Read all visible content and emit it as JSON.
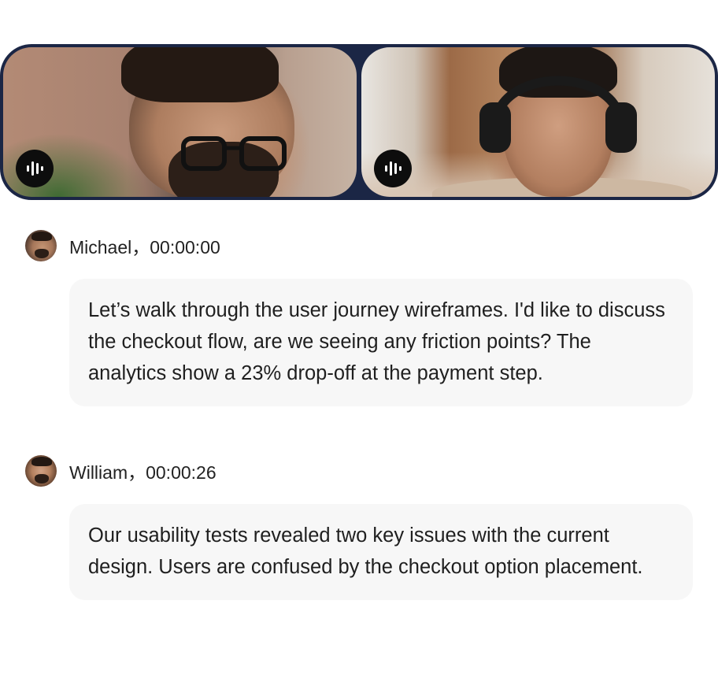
{
  "video_call": {
    "participants": [
      {
        "name": "Michael",
        "audio_icon": "audio-waveform-icon"
      },
      {
        "name": "William",
        "audio_icon": "audio-waveform-icon"
      }
    ],
    "frame_color": "#1b2645"
  },
  "transcript": [
    {
      "speaker": "Michael",
      "timestamp": "00:00:00",
      "header": "Michael，00:00:00",
      "message": "Let’s walk through the user journey wireframes. I'd like to discuss the checkout flow, are we seeing any friction points? The analytics show a 23% drop-off at the payment step."
    },
    {
      "speaker": "William",
      "timestamp": "00:00:26",
      "header": "William，00:00:26",
      "message": "Our usability tests revealed two key issues with the current design. Users are confused by the checkout option placement."
    }
  ],
  "colors": {
    "bubble_background": "#f7f7f7",
    "audio_button": "#0d0d0d",
    "text": "#1f1f1f"
  }
}
